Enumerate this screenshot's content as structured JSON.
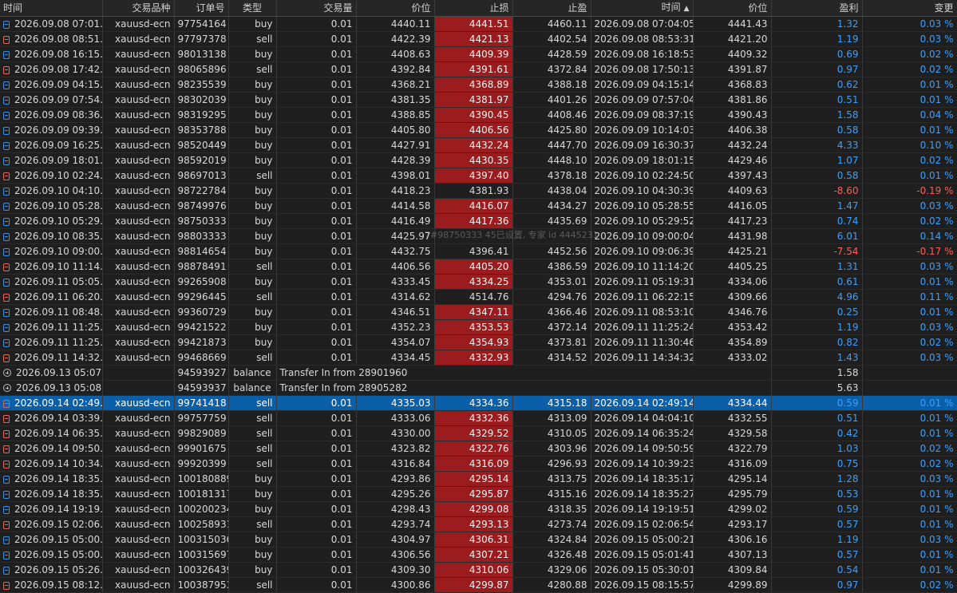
{
  "headers": [
    "时间",
    "交易品种",
    "订单号",
    "类型",
    "交易量",
    "价位",
    "止损",
    "止盈",
    "时间",
    "价位",
    "盈利",
    "变更"
  ],
  "sort_indicator": "▲",
  "watermark": "7#98750333 45已设置, 专家 id 4445231",
  "rows": [
    {
      "kind": "sell",
      "t1": "2026.09.08 07:01...",
      "sym": "xauusd-ecn",
      "order": "97754164",
      "type": "buy",
      "vol": "0.01",
      "price": "4440.11",
      "sl": "4441.51",
      "tp": "4460.11",
      "t2": "2026.09.08 07:04:05",
      "price2": "4441.43",
      "profit": "1.32",
      "change": "0.03 %"
    },
    {
      "kind": "sell",
      "t1": "2026.09.08 08:51...",
      "sym": "xauusd-ecn",
      "order": "97797378",
      "type": "sell",
      "vol": "0.01",
      "price": "4422.39",
      "sl": "4421.13",
      "tp": "4402.54",
      "t2": "2026.09.08 08:53:31",
      "price2": "4421.20",
      "profit": "1.19",
      "change": "0.03 %"
    },
    {
      "kind": "buy",
      "t1": "2026.09.08 16:15...",
      "sym": "xauusd-ecn",
      "order": "98013138",
      "type": "buy",
      "vol": "0.01",
      "price": "4408.63",
      "sl": "4409.39",
      "tp": "4428.59",
      "t2": "2026.09.08 16:18:53",
      "price2": "4409.32",
      "profit": "0.69",
      "change": "0.02 %"
    },
    {
      "kind": "sell",
      "t1": "2026.09.08 17:42...",
      "sym": "xauusd-ecn",
      "order": "98065896",
      "type": "sell",
      "vol": "0.01",
      "price": "4392.84",
      "sl": "4391.61",
      "tp": "4372.84",
      "t2": "2026.09.08 17:50:13",
      "price2": "4391.87",
      "profit": "0.97",
      "change": "0.02 %"
    },
    {
      "kind": "buy",
      "t1": "2026.09.09 04:15...",
      "sym": "xauusd-ecn",
      "order": "98235539",
      "type": "buy",
      "vol": "0.01",
      "price": "4368.21",
      "sl": "4368.89",
      "tp": "4388.18",
      "t2": "2026.09.09 04:15:14",
      "price2": "4368.83",
      "profit": "0.62",
      "change": "0.01 %"
    },
    {
      "kind": "buy",
      "t1": "2026.09.09 07:54...",
      "sym": "xauusd-ecn",
      "order": "98302039",
      "type": "buy",
      "vol": "0.01",
      "price": "4381.35",
      "sl": "4381.97",
      "tp": "4401.26",
      "t2": "2026.09.09 07:57:04",
      "price2": "4381.86",
      "profit": "0.51",
      "change": "0.01 %"
    },
    {
      "kind": "buy",
      "t1": "2026.09.09 08:36...",
      "sym": "xauusd-ecn",
      "order": "98319295",
      "type": "buy",
      "vol": "0.01",
      "price": "4388.85",
      "sl": "4390.45",
      "tp": "4408.46",
      "t2": "2026.09.09 08:37:19",
      "price2": "4390.43",
      "profit": "1.58",
      "change": "0.04 %"
    },
    {
      "kind": "buy",
      "t1": "2026.09.09 09:39...",
      "sym": "xauusd-ecn",
      "order": "98353788",
      "type": "buy",
      "vol": "0.01",
      "price": "4405.80",
      "sl": "4406.56",
      "tp": "4425.80",
      "t2": "2026.09.09 10:14:03",
      "price2": "4406.38",
      "profit": "0.58",
      "change": "0.01 %"
    },
    {
      "kind": "buy",
      "t1": "2026.09.09 16:25...",
      "sym": "xauusd-ecn",
      "order": "98520449",
      "type": "buy",
      "vol": "0.01",
      "price": "4427.91",
      "sl": "4432.24",
      "tp": "4447.70",
      "t2": "2026.09.09 16:30:37",
      "price2": "4432.24",
      "profit": "4.33",
      "change": "0.10 %"
    },
    {
      "kind": "buy",
      "t1": "2026.09.09 18:01...",
      "sym": "xauusd-ecn",
      "order": "98592019",
      "type": "buy",
      "vol": "0.01",
      "price": "4428.39",
      "sl": "4430.35",
      "tp": "4448.10",
      "t2": "2026.09.09 18:01:15",
      "price2": "4429.46",
      "profit": "1.07",
      "change": "0.02 %"
    },
    {
      "kind": "sell",
      "t1": "2026.09.10 02:24...",
      "sym": "xauusd-ecn",
      "order": "98697013",
      "type": "sell",
      "vol": "0.01",
      "price": "4398.01",
      "sl": "4397.40",
      "tp": "4378.18",
      "t2": "2026.09.10 02:24:50",
      "price2": "4397.43",
      "profit": "0.58",
      "change": "0.01 %"
    },
    {
      "kind": "buy",
      "t1": "2026.09.10 04:10...",
      "sym": "xauusd-ecn",
      "order": "98722784",
      "type": "buy",
      "vol": "0.01",
      "price": "4418.23",
      "sl": "4381.93",
      "tp": "4438.04",
      "t2": "2026.09.10 04:30:39",
      "price2": "4409.63",
      "profit": "-8.60",
      "change": "-0.19 %",
      "slplain": true
    },
    {
      "kind": "buy",
      "t1": "2026.09.10 05:28...",
      "sym": "xauusd-ecn",
      "order": "98749976",
      "type": "buy",
      "vol": "0.01",
      "price": "4414.58",
      "sl": "4416.07",
      "tp": "4434.27",
      "t2": "2026.09.10 05:28:55",
      "price2": "4416.05",
      "profit": "1.47",
      "change": "0.03 %"
    },
    {
      "kind": "buy",
      "t1": "2026.09.10 05:29...",
      "sym": "xauusd-ecn",
      "order": "98750333",
      "type": "buy",
      "vol": "0.01",
      "price": "4416.49",
      "sl": "4417.36",
      "tp": "4435.69",
      "t2": "2026.09.10 05:29:52",
      "price2": "4417.23",
      "profit": "0.74",
      "change": "0.02 %"
    },
    {
      "kind": "buy",
      "t1": "2026.09.10 08:35...",
      "sym": "xauusd-ecn",
      "order": "98803333",
      "type": "buy",
      "vol": "0.01",
      "price": "4425.97",
      "sl": "",
      "tp": "",
      "t2": "2026.09.10 09:00:04",
      "price2": "4431.98",
      "profit": "6.01",
      "change": "0.14 %",
      "slplain": true
    },
    {
      "kind": "buy",
      "t1": "2026.09.10 09:00...",
      "sym": "xauusd-ecn",
      "order": "98814654",
      "type": "buy",
      "vol": "0.01",
      "price": "4432.75",
      "sl": "4396.41",
      "tp": "4452.56",
      "t2": "2026.09.10 09:06:39",
      "price2": "4425.21",
      "profit": "-7.54",
      "change": "-0.17 %",
      "slplain": true
    },
    {
      "kind": "sell",
      "t1": "2026.09.10 11:14...",
      "sym": "xauusd-ecn",
      "order": "98878491",
      "type": "sell",
      "vol": "0.01",
      "price": "4406.56",
      "sl": "4405.20",
      "tp": "4386.59",
      "t2": "2026.09.10 11:14:20",
      "price2": "4405.25",
      "profit": "1.31",
      "change": "0.03 %"
    },
    {
      "kind": "buy",
      "t1": "2026.09.11 05:05...",
      "sym": "xauusd-ecn",
      "order": "99265908",
      "type": "buy",
      "vol": "0.01",
      "price": "4333.45",
      "sl": "4334.25",
      "tp": "4353.01",
      "t2": "2026.09.11 05:19:31",
      "price2": "4334.06",
      "profit": "0.61",
      "change": "0.01 %"
    },
    {
      "kind": "sell",
      "t1": "2026.09.11 06:20...",
      "sym": "xauusd-ecn",
      "order": "99296445",
      "type": "sell",
      "vol": "0.01",
      "price": "4314.62",
      "sl": "4514.76",
      "tp": "4294.76",
      "t2": "2026.09.11 06:22:15",
      "price2": "4309.66",
      "profit": "4.96",
      "change": "0.11 %",
      "slplain": true
    },
    {
      "kind": "buy",
      "t1": "2026.09.11 08:48...",
      "sym": "xauusd-ecn",
      "order": "99360729",
      "type": "buy",
      "vol": "0.01",
      "price": "4346.51",
      "sl": "4347.11",
      "tp": "4366.46",
      "t2": "2026.09.11 08:53:10",
      "price2": "4346.76",
      "profit": "0.25",
      "change": "0.01 %"
    },
    {
      "kind": "buy",
      "t1": "2026.09.11 11:25...",
      "sym": "xauusd-ecn",
      "order": "99421522",
      "type": "buy",
      "vol": "0.01",
      "price": "4352.23",
      "sl": "4353.53",
      "tp": "4372.14",
      "t2": "2026.09.11 11:25:24",
      "price2": "4353.42",
      "profit": "1.19",
      "change": "0.03 %"
    },
    {
      "kind": "buy",
      "t1": "2026.09.11 11:25...",
      "sym": "xauusd-ecn",
      "order": "99421873",
      "type": "buy",
      "vol": "0.01",
      "price": "4354.07",
      "sl": "4354.93",
      "tp": "4373.81",
      "t2": "2026.09.11 11:30:46",
      "price2": "4354.89",
      "profit": "0.82",
      "change": "0.02 %"
    },
    {
      "kind": "sell",
      "t1": "2026.09.11 14:32...",
      "sym": "xauusd-ecn",
      "order": "99468669",
      "type": "sell",
      "vol": "0.01",
      "price": "4334.45",
      "sl": "4332.93",
      "tp": "4314.52",
      "t2": "2026.09.11 14:34:32",
      "price2": "4333.02",
      "profit": "1.43",
      "change": "0.03 %"
    },
    {
      "kind": "balance",
      "t1": "2026.09.13 05:07...",
      "order": "94593927",
      "type": "balance",
      "comment": "Transfer In from 28901960",
      "profit": "1.58"
    },
    {
      "kind": "balance",
      "t1": "2026.09.13 05:08...",
      "order": "94593937",
      "type": "balance",
      "comment": "Transfer In from 28905282",
      "profit": "5.63"
    },
    {
      "kind": "sell",
      "selected": true,
      "t1": "2026.09.14 02:49...",
      "sym": "xauusd-ecn",
      "order": "99741418",
      "type": "sell",
      "vol": "0.01",
      "price": "4335.03",
      "sl": "4334.36",
      "tp": "4315.18",
      "t2": "2026.09.14 02:49:14",
      "price2": "4334.44",
      "profit": "0.59",
      "change": "0.01 %"
    },
    {
      "kind": "sell",
      "t1": "2026.09.14 03:39...",
      "sym": "xauusd-ecn",
      "order": "99757759",
      "type": "sell",
      "vol": "0.01",
      "price": "4333.06",
      "sl": "4332.36",
      "tp": "4313.09",
      "t2": "2026.09.14 04:04:10",
      "price2": "4332.55",
      "profit": "0.51",
      "change": "0.01 %"
    },
    {
      "kind": "sell",
      "t1": "2026.09.14 06:35...",
      "sym": "xauusd-ecn",
      "order": "99829089",
      "type": "sell",
      "vol": "0.01",
      "price": "4330.00",
      "sl": "4329.52",
      "tp": "4310.05",
      "t2": "2026.09.14 06:35:24",
      "price2": "4329.58",
      "profit": "0.42",
      "change": "0.01 %"
    },
    {
      "kind": "sell",
      "t1": "2026.09.14 09:50...",
      "sym": "xauusd-ecn",
      "order": "99901675",
      "type": "sell",
      "vol": "0.01",
      "price": "4323.82",
      "sl": "4322.76",
      "tp": "4303.96",
      "t2": "2026.09.14 09:50:59",
      "price2": "4322.79",
      "profit": "1.03",
      "change": "0.02 %"
    },
    {
      "kind": "sell",
      "t1": "2026.09.14 10:34...",
      "sym": "xauusd-ecn",
      "order": "99920399",
      "type": "sell",
      "vol": "0.01",
      "price": "4316.84",
      "sl": "4316.09",
      "tp": "4296.93",
      "t2": "2026.09.14 10:39:23",
      "price2": "4316.09",
      "profit": "0.75",
      "change": "0.02 %"
    },
    {
      "kind": "buy",
      "t1": "2026.09.14 18:35...",
      "sym": "xauusd-ecn",
      "order": "100180889",
      "type": "buy",
      "vol": "0.01",
      "price": "4293.86",
      "sl": "4295.14",
      "tp": "4313.75",
      "t2": "2026.09.14 18:35:17",
      "price2": "4295.14",
      "profit": "1.28",
      "change": "0.03 %"
    },
    {
      "kind": "buy",
      "t1": "2026.09.14 18:35...",
      "sym": "xauusd-ecn",
      "order": "100181317",
      "type": "buy",
      "vol": "0.01",
      "price": "4295.26",
      "sl": "4295.87",
      "tp": "4315.16",
      "t2": "2026.09.14 18:35:27",
      "price2": "4295.79",
      "profit": "0.53",
      "change": "0.01 %"
    },
    {
      "kind": "buy",
      "t1": "2026.09.14 19:19...",
      "sym": "xauusd-ecn",
      "order": "100200234",
      "type": "buy",
      "vol": "0.01",
      "price": "4298.43",
      "sl": "4299.08",
      "tp": "4318.35",
      "t2": "2026.09.14 19:19:51",
      "price2": "4299.02",
      "profit": "0.59",
      "change": "0.01 %"
    },
    {
      "kind": "sell",
      "t1": "2026.09.15 02:06...",
      "sym": "xauusd-ecn",
      "order": "100258931",
      "type": "sell",
      "vol": "0.01",
      "price": "4293.74",
      "sl": "4293.13",
      "tp": "4273.74",
      "t2": "2026.09.15 02:06:54",
      "price2": "4293.17",
      "profit": "0.57",
      "change": "0.01 %"
    },
    {
      "kind": "buy",
      "t1": "2026.09.15 05:00...",
      "sym": "xauusd-ecn",
      "order": "100315036",
      "type": "buy",
      "vol": "0.01",
      "price": "4304.97",
      "sl": "4306.31",
      "tp": "4324.84",
      "t2": "2026.09.15 05:00:21",
      "price2": "4306.16",
      "profit": "1.19",
      "change": "0.03 %"
    },
    {
      "kind": "buy",
      "t1": "2026.09.15 05:00...",
      "sym": "xauusd-ecn",
      "order": "100315697",
      "type": "buy",
      "vol": "0.01",
      "price": "4306.56",
      "sl": "4307.21",
      "tp": "4326.48",
      "t2": "2026.09.15 05:01:41",
      "price2": "4307.13",
      "profit": "0.57",
      "change": "0.01 %"
    },
    {
      "kind": "buy",
      "t1": "2026.09.15 05:26...",
      "sym": "xauusd-ecn",
      "order": "100326439",
      "type": "buy",
      "vol": "0.01",
      "price": "4309.30",
      "sl": "4310.06",
      "tp": "4329.06",
      "t2": "2026.09.15 05:30:01",
      "price2": "4309.84",
      "profit": "0.54",
      "change": "0.01 %"
    },
    {
      "kind": "sell",
      "t1": "2026.09.15 08:12...",
      "sym": "xauusd-ecn",
      "order": "100387953",
      "type": "sell",
      "vol": "0.01",
      "price": "4300.86",
      "sl": "4299.87",
      "tp": "4280.88",
      "t2": "2026.09.15 08:15:57",
      "price2": "4299.89",
      "profit": "0.97",
      "change": "0.02 %"
    }
  ]
}
